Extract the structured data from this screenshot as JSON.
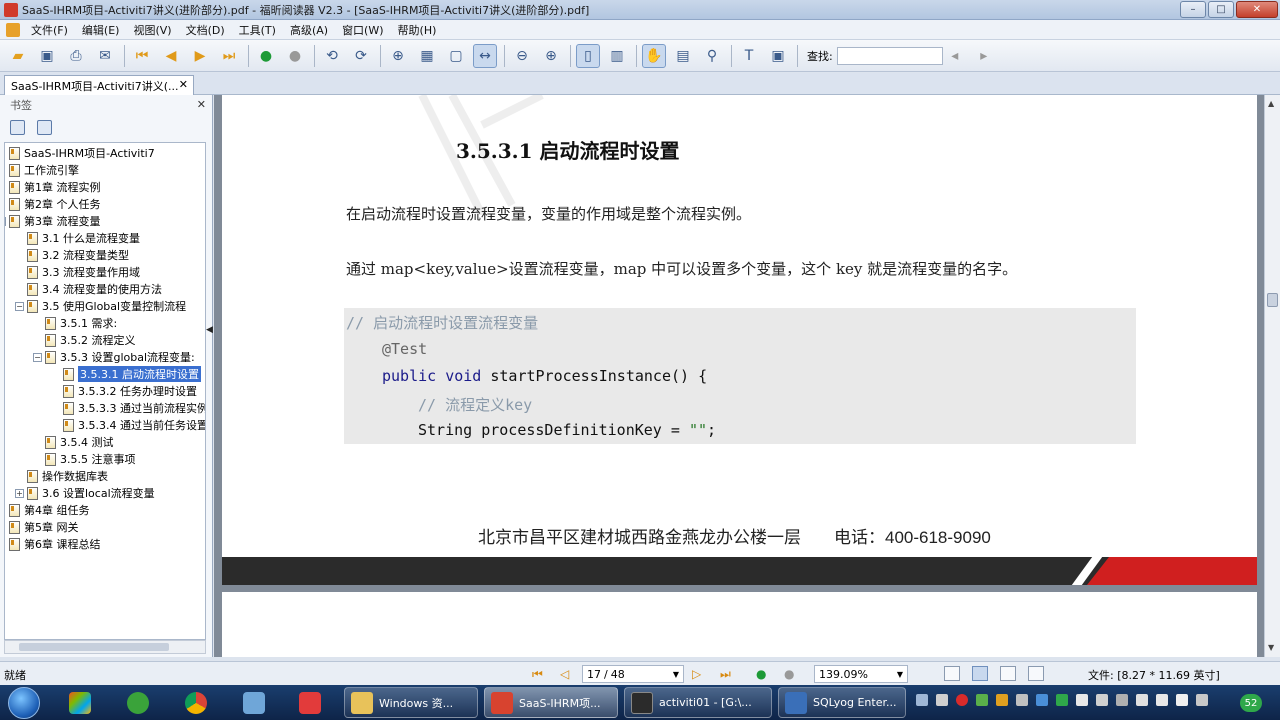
{
  "window": {
    "title": "SaaS-IHRM项目-Activiti7讲义(进阶部分).pdf - 福昕阅读器 V2.3 - [SaaS-IHRM项目-Activiti7讲义(进阶部分).pdf]",
    "min_glyph": "–",
    "max_glyph": "□",
    "close_glyph": "✕"
  },
  "menu": [
    "文件(F)",
    "编辑(E)",
    "视图(V)",
    "文档(D)",
    "工具(T)",
    "高级(A)",
    "窗口(W)",
    "帮助(H)"
  ],
  "toolbar": {
    "search_label": "查找:",
    "search_value": ""
  },
  "tab": {
    "label": "SaaS-IHRM项目-Activiti7讲义(...",
    "close_glyph": "✕"
  },
  "sidebar": {
    "title": "书签",
    "close_glyph": "✕",
    "bookmarks": [
      {
        "label": "SaaS-IHRM项目-Activiti7",
        "level": 0
      },
      {
        "label": "工作流引擎",
        "level": 0
      },
      {
        "label": "第1章 流程实例",
        "level": 0
      },
      {
        "label": "第2章 个人任务",
        "level": 0
      },
      {
        "label": "第3章 流程变量",
        "level": 0
      },
      {
        "label": "3.1 什么是流程变量",
        "level": 1
      },
      {
        "label": "3.2 流程变量类型",
        "level": 1
      },
      {
        "label": "3.3 流程变量作用域",
        "level": 1
      },
      {
        "label": "3.4 流程变量的使用方法",
        "level": 1
      },
      {
        "label": "3.5 使用Global变量控制流程",
        "level": 1
      },
      {
        "label": "3.5.1 需求:",
        "level": 2
      },
      {
        "label": "3.5.2 流程定义",
        "level": 2
      },
      {
        "label": "3.5.3 设置global流程变量:",
        "level": 2
      },
      {
        "label": "3.5.3.1 启动流程时设置",
        "level": 3,
        "selected": true
      },
      {
        "label": "3.5.3.2 任务办理时设置",
        "level": 3
      },
      {
        "label": "3.5.3.3 通过当前流程实例",
        "level": 3
      },
      {
        "label": "3.5.3.4 通过当前任务设置",
        "level": 3
      },
      {
        "label": "3.5.4 测试",
        "level": 2
      },
      {
        "label": "3.5.5 注意事项",
        "level": 2
      },
      {
        "label": "操作数据库表",
        "level": 1
      },
      {
        "label": "3.6 设置local流程变量",
        "level": 1
      },
      {
        "label": "第4章 组任务",
        "level": 0
      },
      {
        "label": "第5章 网关",
        "level": 0
      },
      {
        "label": "第6章 课程总结",
        "level": 0
      }
    ]
  },
  "document": {
    "heading": "3.5.3.1 启动流程时设置",
    "para1": "在启动流程时设置流程变量，变量的作用域是整个流程实例。",
    "para2": "通过 map<key,value>设置流程变量，map 中可以设置多个变量，这个 key 就是流程变量的名字。",
    "code": {
      "line1": "// 启动流程时设置流程变量",
      "line2": "@Test",
      "line3_kw": "public void",
      "line3_rest": " startProcessInstance() {",
      "line4": "// 流程定义key",
      "line5_a": "String processDefinitionKey = ",
      "line5_str": "\"\"",
      "line5_b": ";"
    },
    "footer_address": "北京市昌平区建材城西路金燕龙办公楼一层",
    "footer_phone": "电话：400-618-9090"
  },
  "statusbar": {
    "ready": "就绪",
    "page_current": "17",
    "page_sep": "/",
    "page_total": "48",
    "zoom": "139.09%",
    "file_size": "文件: [8.27 * 11.69 英寸]"
  },
  "taskbar": {
    "tasks": [
      {
        "label": "Windows 资...",
        "color": "#e8c25a"
      },
      {
        "label": "SaaS-IHRM项...",
        "color": "#d8432f"
      },
      {
        "label": "activiti01 - [G:\\...",
        "color": "#2b2b2b"
      },
      {
        "label": "SQLyog Enter...",
        "color": "#3a6fb8"
      }
    ],
    "tray_badge": "52"
  },
  "colors": {
    "selection": "#3a6fd0",
    "band_dark": "#2b2b2b",
    "band_red": "#d01f1f",
    "code_bg": "#e9e9e9"
  }
}
